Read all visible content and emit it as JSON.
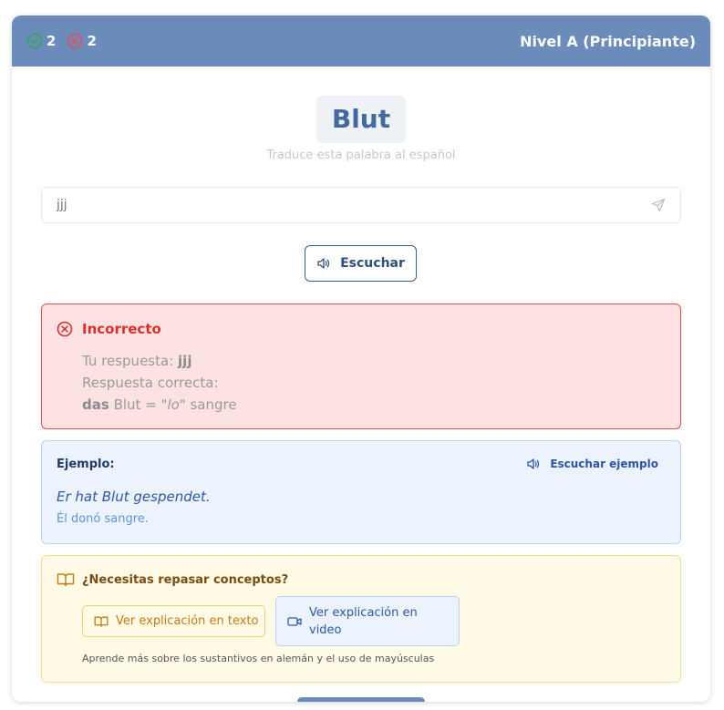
{
  "header": {
    "correct_count": "2",
    "wrong_count": "2",
    "level": "Nivel A (Principiante)",
    "correct_color": "#2fa84f",
    "wrong_color": "#e25050"
  },
  "card": {
    "word": "Blut",
    "prompt": "Traduce esta palabra al español"
  },
  "input": {
    "value": "jjj",
    "send_icon": "send-icon"
  },
  "listen_button": {
    "label": "Escuchar",
    "icon": "speaker-icon"
  },
  "feedback": {
    "title": "Incorrecto",
    "your_answer_label": "Tu respuesta:",
    "your_answer": "jjj",
    "correct_label": "Respuesta correcta:",
    "article": "das",
    "noun": "Blut =",
    "gender_hint": "\"lo\"",
    "translation": "sangre",
    "color": "#d9302e"
  },
  "example": {
    "label": "Ejemplo:",
    "listen_label": "Escuchar ejemplo",
    "sentence": "Er hat Blut gespendet.",
    "translation": "Él donó sangre."
  },
  "review": {
    "title": "¿Necesitas repasar conceptos?",
    "text_button": "Ver explicación en texto",
    "video_button": "Ver explicación en video",
    "note": "Aprende más sobre los sustantivos en alemán y el uso de mayúsculas"
  }
}
